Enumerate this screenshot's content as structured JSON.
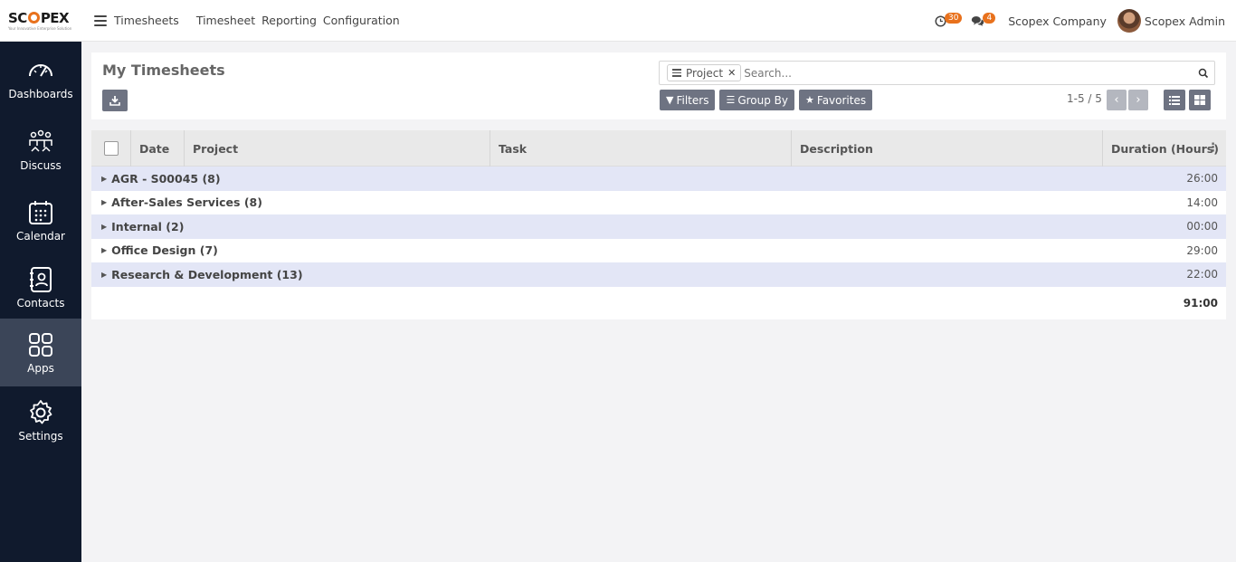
{
  "brand": {
    "name_start": "SC",
    "name_end": "PEX",
    "tagline": "Your Innovative Enterprise Solution"
  },
  "topbar": {
    "app_name": "Timesheets",
    "menu": [
      "Timesheet",
      "Reporting",
      "Configuration"
    ],
    "activity_count": "30",
    "message_count": "4",
    "company": "Scopex Company",
    "user": "Scopex Admin"
  },
  "sidebar": {
    "items": [
      {
        "label": "Dashboards",
        "icon": "speedometer-icon"
      },
      {
        "label": "Discuss",
        "icon": "discuss-people-icon"
      },
      {
        "label": "Calendar",
        "icon": "calendar-icon"
      },
      {
        "label": "Contacts",
        "icon": "contact-book-icon"
      },
      {
        "label": "Apps",
        "icon": "apps-grid-icon",
        "active": true
      },
      {
        "label": "Settings",
        "icon": "gear-icon"
      }
    ]
  },
  "control": {
    "title": "My Timesheets",
    "facet": "Project",
    "search_placeholder": "Search...",
    "filters_label": "Filters",
    "groupby_label": "Group By",
    "favorites_label": "Favorites",
    "pager": "1-5 / 5"
  },
  "table": {
    "columns": {
      "date": "Date",
      "project": "Project",
      "task": "Task",
      "description": "Description",
      "duration": "Duration (Hours)"
    },
    "groups": [
      {
        "label": "AGR - S00045 (8)",
        "duration": "26:00"
      },
      {
        "label": "After-Sales Services (8)",
        "duration": "14:00"
      },
      {
        "label": "Internal (2)",
        "duration": "00:00"
      },
      {
        "label": "Office Design (7)",
        "duration": "29:00"
      },
      {
        "label": "Research & Development (13)",
        "duration": "22:00"
      }
    ],
    "total": "91:00"
  },
  "colors": {
    "sidebar_bg": "#101a2d",
    "sidebar_active": "#3b4558",
    "accent": "#e8711c",
    "button": "#6e7382",
    "group_row": "#e3e6f6"
  }
}
